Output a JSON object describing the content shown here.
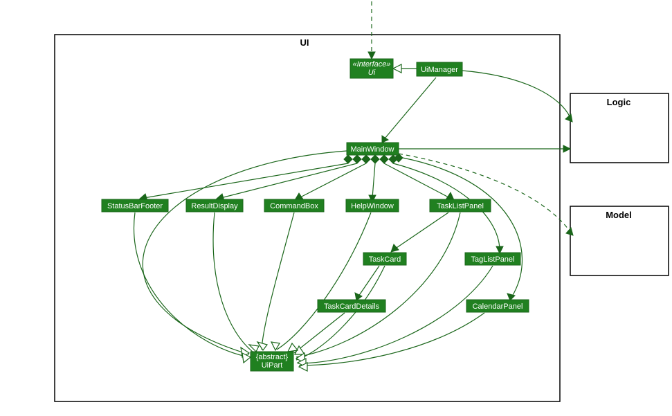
{
  "packages": {
    "ui": {
      "label": "UI"
    },
    "logic": {
      "label": "Logic"
    },
    "model": {
      "label": "Model"
    }
  },
  "classes": {
    "ui_interface": {
      "stereotype": "«Interface»",
      "name": "Ui"
    },
    "ui_manager": {
      "name": "UiManager"
    },
    "main_window": {
      "name": "MainWindow"
    },
    "status_bar_footer": {
      "name": "StatusBarFooter"
    },
    "result_display": {
      "name": "ResultDisplay"
    },
    "command_box": {
      "name": "CommandBox"
    },
    "help_window": {
      "name": "HelpWindow"
    },
    "task_list_panel": {
      "name": "TaskListPanel"
    },
    "task_card": {
      "name": "TaskCard"
    },
    "tag_list_panel": {
      "name": "TagListPanel"
    },
    "task_card_details": {
      "name": "TaskCardDetails"
    },
    "calendar_panel": {
      "name": "CalendarPanel"
    },
    "ui_part": {
      "stereotype": "{abstract}",
      "name": "UiPart"
    }
  },
  "chart_data": {
    "type": "uml-class-diagram",
    "packages": [
      "UI",
      "Logic",
      "Model"
    ],
    "classes": [
      {
        "id": "Ui",
        "package": "UI",
        "stereotype": "interface"
      },
      {
        "id": "UiManager",
        "package": "UI"
      },
      {
        "id": "MainWindow",
        "package": "UI"
      },
      {
        "id": "StatusBarFooter",
        "package": "UI"
      },
      {
        "id": "ResultDisplay",
        "package": "UI"
      },
      {
        "id": "CommandBox",
        "package": "UI"
      },
      {
        "id": "HelpWindow",
        "package": "UI"
      },
      {
        "id": "TaskListPanel",
        "package": "UI"
      },
      {
        "id": "TaskCard",
        "package": "UI"
      },
      {
        "id": "TagListPanel",
        "package": "UI"
      },
      {
        "id": "TaskCardDetails",
        "package": "UI"
      },
      {
        "id": "CalendarPanel",
        "package": "UI"
      },
      {
        "id": "UiPart",
        "package": "UI",
        "stereotype": "abstract"
      }
    ],
    "relations": [
      {
        "from": "external",
        "to": "Ui",
        "type": "dependency"
      },
      {
        "from": "UiManager",
        "to": "Ui",
        "type": "realization"
      },
      {
        "from": "UiManager",
        "to": "MainWindow",
        "type": "association-directed"
      },
      {
        "from": "UiManager",
        "to": "Logic",
        "type": "association-directed"
      },
      {
        "from": "MainWindow",
        "to": "Logic",
        "type": "association-directed"
      },
      {
        "from": "MainWindow",
        "to": "Model",
        "type": "dependency"
      },
      {
        "from": "MainWindow",
        "to": "StatusBarFooter",
        "type": "composition"
      },
      {
        "from": "MainWindow",
        "to": "ResultDisplay",
        "type": "composition"
      },
      {
        "from": "MainWindow",
        "to": "CommandBox",
        "type": "composition"
      },
      {
        "from": "MainWindow",
        "to": "HelpWindow",
        "type": "composition"
      },
      {
        "from": "MainWindow",
        "to": "TaskListPanel",
        "type": "composition"
      },
      {
        "from": "MainWindow",
        "to": "TagListPanel",
        "type": "composition"
      },
      {
        "from": "MainWindow",
        "to": "CalendarPanel",
        "type": "composition"
      },
      {
        "from": "TaskListPanel",
        "to": "TaskCard",
        "type": "association-directed"
      },
      {
        "from": "TaskCard",
        "to": "TaskCardDetails",
        "type": "association-directed"
      },
      {
        "from": "MainWindow",
        "to": "UiPart",
        "type": "generalization"
      },
      {
        "from": "StatusBarFooter",
        "to": "UiPart",
        "type": "generalization"
      },
      {
        "from": "ResultDisplay",
        "to": "UiPart",
        "type": "generalization"
      },
      {
        "from": "CommandBox",
        "to": "UiPart",
        "type": "generalization"
      },
      {
        "from": "HelpWindow",
        "to": "UiPart",
        "type": "generalization"
      },
      {
        "from": "TaskListPanel",
        "to": "UiPart",
        "type": "generalization"
      },
      {
        "from": "TaskCard",
        "to": "UiPart",
        "type": "generalization"
      },
      {
        "from": "TagListPanel",
        "to": "UiPart",
        "type": "generalization"
      },
      {
        "from": "TaskCardDetails",
        "to": "UiPart",
        "type": "generalization"
      },
      {
        "from": "CalendarPanel",
        "to": "UiPart",
        "type": "generalization"
      }
    ]
  }
}
